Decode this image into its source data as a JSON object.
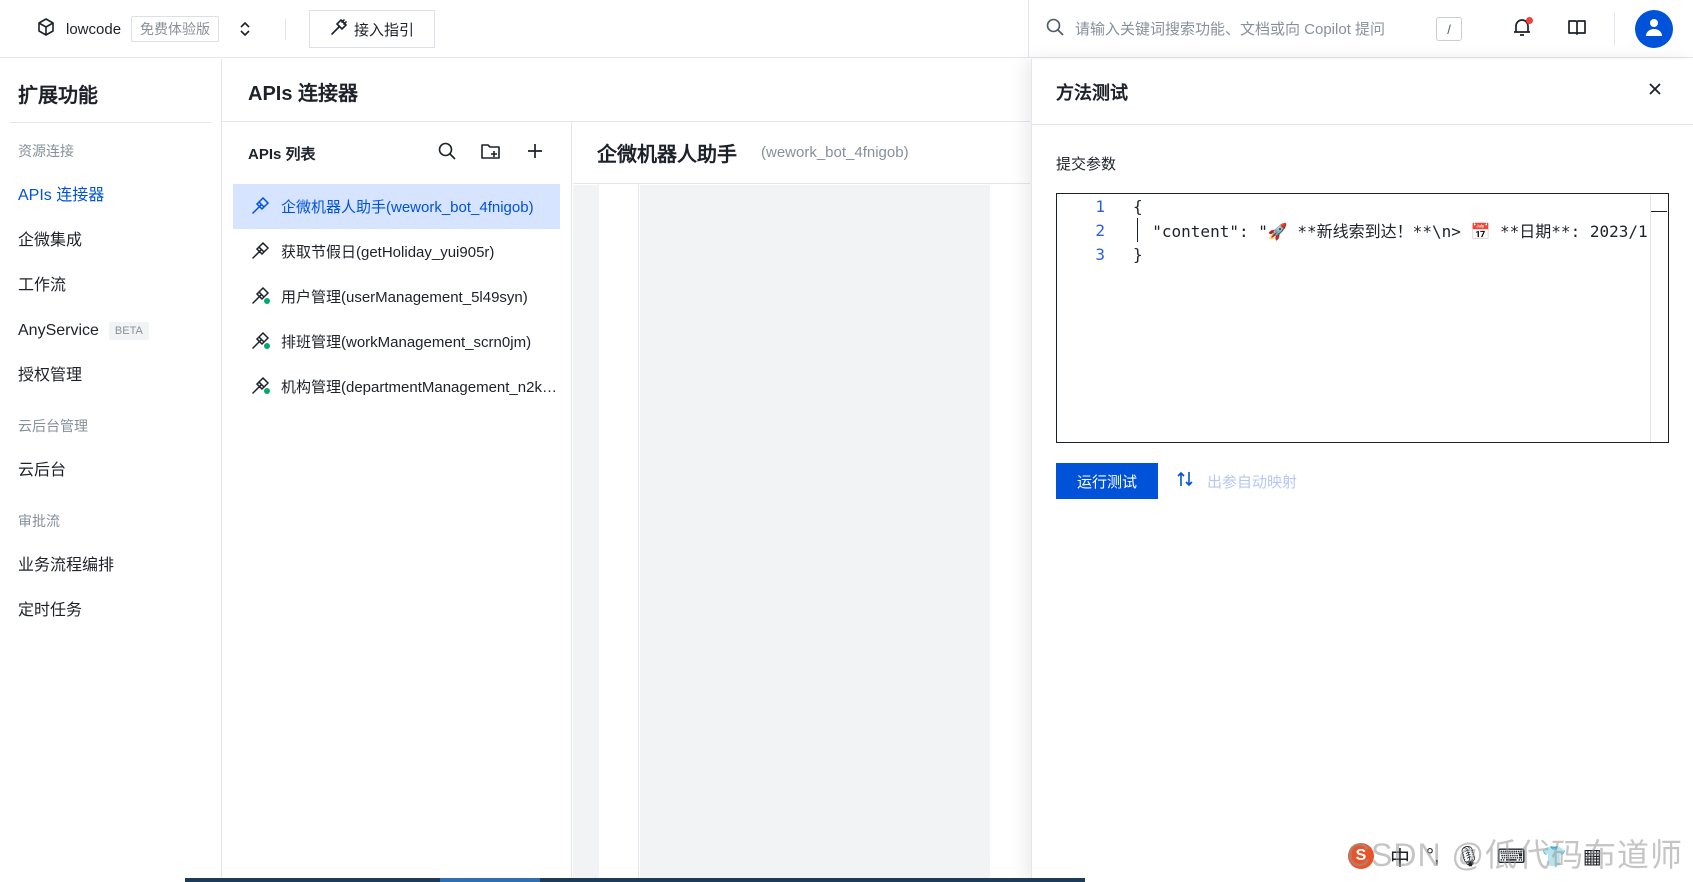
{
  "topbar": {
    "app_name": "lowcode",
    "edition": "免费体验版",
    "guide_button": "接入指引",
    "search_placeholder": "请输入关键词搜索功能、文档或向 Copilot 提问",
    "search_shortcut": "/"
  },
  "sidebar": {
    "title": "扩展功能",
    "groups": [
      {
        "label": "资源连接",
        "items": [
          {
            "label": "APIs 连接器",
            "active": true
          },
          {
            "label": "企微集成"
          },
          {
            "label": "工作流"
          },
          {
            "label": "AnyService",
            "badge": "BETA"
          },
          {
            "label": "授权管理"
          }
        ]
      },
      {
        "label": "云后台管理",
        "items": [
          {
            "label": "云后台"
          }
        ]
      },
      {
        "label": "审批流",
        "items": [
          {
            "label": "业务流程编排"
          },
          {
            "label": "定时任务"
          }
        ]
      }
    ]
  },
  "main": {
    "title": "APIs 连接器",
    "list_title": "APIs 列表",
    "apis": [
      {
        "label": "企微机器人助手(wework_bot_4fnigob)",
        "active": true
      },
      {
        "label": "获取节假日(getHoliday_yui905r)"
      },
      {
        "label": "用户管理(userManagement_5l49syn)"
      },
      {
        "label": "排班管理(workManagement_scrn0jm)"
      },
      {
        "label": "机构管理(departmentManagement_n2kt…"
      }
    ],
    "detail_title": "企微机器人助手",
    "detail_id": "(wework_bot_4fnigob)"
  },
  "drawer": {
    "title": "方法测试",
    "param_label": "提交参数",
    "code_lines": [
      {
        "num": "1",
        "text": "{"
      },
      {
        "num": "2",
        "text": "  \"content\": \"🚀 **新线索到达！**\\n> 📅 **日期**: 2023/1"
      },
      {
        "num": "3",
        "text": "}"
      }
    ],
    "run_button": "运行测试",
    "map_link": "出参自动映射"
  },
  "watermark": "CSDN @低代码布道师",
  "ime": {
    "lang": "中"
  },
  "colors": {
    "primary": "#0052d9",
    "active_bg": "#d6e4ff",
    "notify_dot": "#f53f3f"
  }
}
